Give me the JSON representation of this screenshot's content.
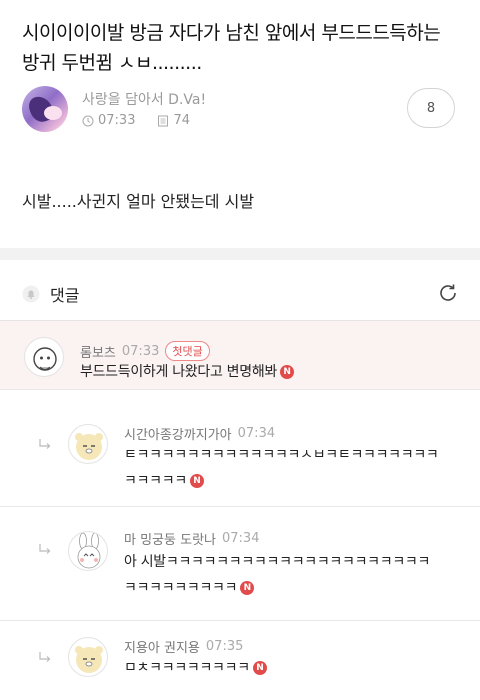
{
  "post": {
    "title": "시이이이이발 방금 자다가 남친 앞에서 부드드드득하는 방귀 두번뀜 ㅅㅂ.........",
    "author": "사랑을 담아서 D.Va!",
    "time": "07:33",
    "views": "74",
    "comment_count": "8",
    "body": "시발.....사귄지 얼마 안됐는데 시발"
  },
  "comments_section": {
    "title": "댓글"
  },
  "comments": [
    {
      "name": "롬보츠",
      "time": "07:33",
      "badge": "첫댓글",
      "text": "부드드득이하게 나왔다고 변명해봐",
      "n": "N"
    },
    {
      "name": "시간아종강까지가아",
      "time": "07:34",
      "text_line1": "ㅌㅋㅋㅋㅋㅋㅋㅋㅋㅋㅋㅋㅋㅋㅅㅂㅋㅌㅋㅋㅋㅋㅋㅋㅋ",
      "text_line2": "ㅋㅋㅋㅋㅋ",
      "n": "N"
    },
    {
      "name": "마 밍궁둥 도랏나",
      "time": "07:34",
      "text_line1": "아 시발ㅋㅋㅋㅋㅋㅋㅋㅋㅋㅋㅋㅋㅋㅋㅋㅋㅋㅋㅋㅋㅋ",
      "text_line2": "ㅋㅋㅋㅋㅋㅋㅋㅋㅋ",
      "n": "N"
    },
    {
      "name": "지용아 권지용",
      "time": "07:35",
      "text": "ㅁㅊㅋㅋㅋㅋㅋㅋㅋㅋ",
      "n": "N"
    }
  ],
  "colors": {
    "accent": "#e24b4b",
    "highlight_bg": "#fbf2f2",
    "muted": "#9a9a9a"
  }
}
